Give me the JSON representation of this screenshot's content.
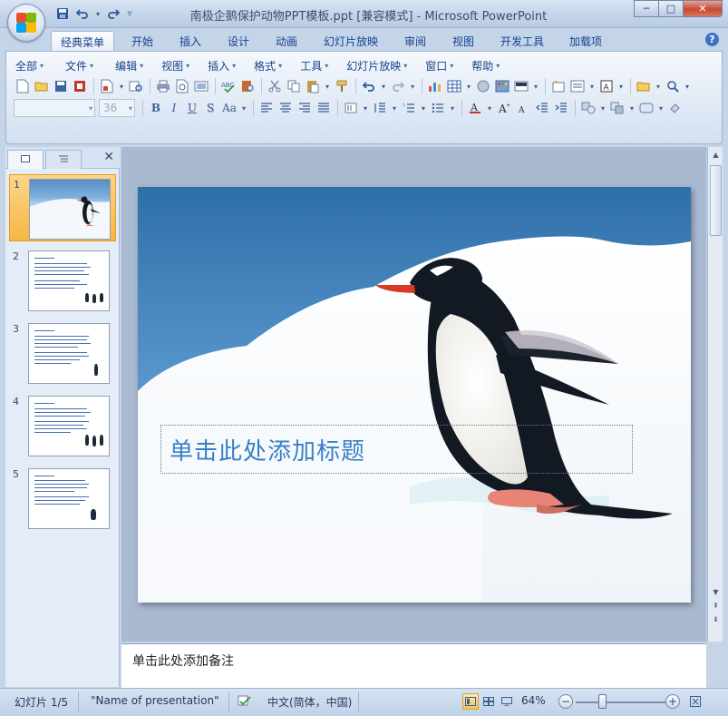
{
  "window": {
    "title": "南极企鹅保护动物PPT模板.ppt [兼容模式] - Microsoft PowerPoint",
    "controls": {
      "minimize": "─",
      "maximize": "□",
      "close": "✕"
    }
  },
  "quick_access": {
    "save": "💾",
    "undo": "↶",
    "redo": "↷",
    "customize": "▿"
  },
  "ribbon_tabs": [
    "经典菜单",
    "开始",
    "插入",
    "设计",
    "动画",
    "幻灯片放映",
    "审阅",
    "视图",
    "开发工具",
    "加载项"
  ],
  "active_tab": "经典菜单",
  "help": "?",
  "menus": [
    "全部",
    "文件",
    "编辑",
    "视图",
    "插入",
    "格式",
    "工具",
    "幻灯片放映",
    "窗口",
    "帮助"
  ],
  "format_bar": {
    "font_name": "",
    "font_size": "36",
    "bold": "B",
    "italic": "I",
    "underline": "U",
    "shadow": "S",
    "case": "Aa"
  },
  "slide_pane": {
    "tab_slides_icon": "slides-tab-icon",
    "tab_outline_icon": "outline-tab-icon",
    "close": "✕",
    "slides": [
      {
        "num": "1"
      },
      {
        "num": "2"
      },
      {
        "num": "3"
      },
      {
        "num": "4"
      },
      {
        "num": "5"
      }
    ],
    "selected": "1"
  },
  "slide": {
    "title_placeholder": "单击此处添加标题"
  },
  "notes": {
    "placeholder": "单击此处添加备注"
  },
  "status_bar": {
    "slide_info": "幻灯片 1/5",
    "theme": "\"Name of presentation\"",
    "language": "中文(简体，中国)",
    "zoom": "64%",
    "zoom_minus": "−",
    "zoom_plus": "+"
  },
  "colors": {
    "accent": "#15428b",
    "title_text": "#3a7fc6",
    "selection": "#f6b645"
  }
}
